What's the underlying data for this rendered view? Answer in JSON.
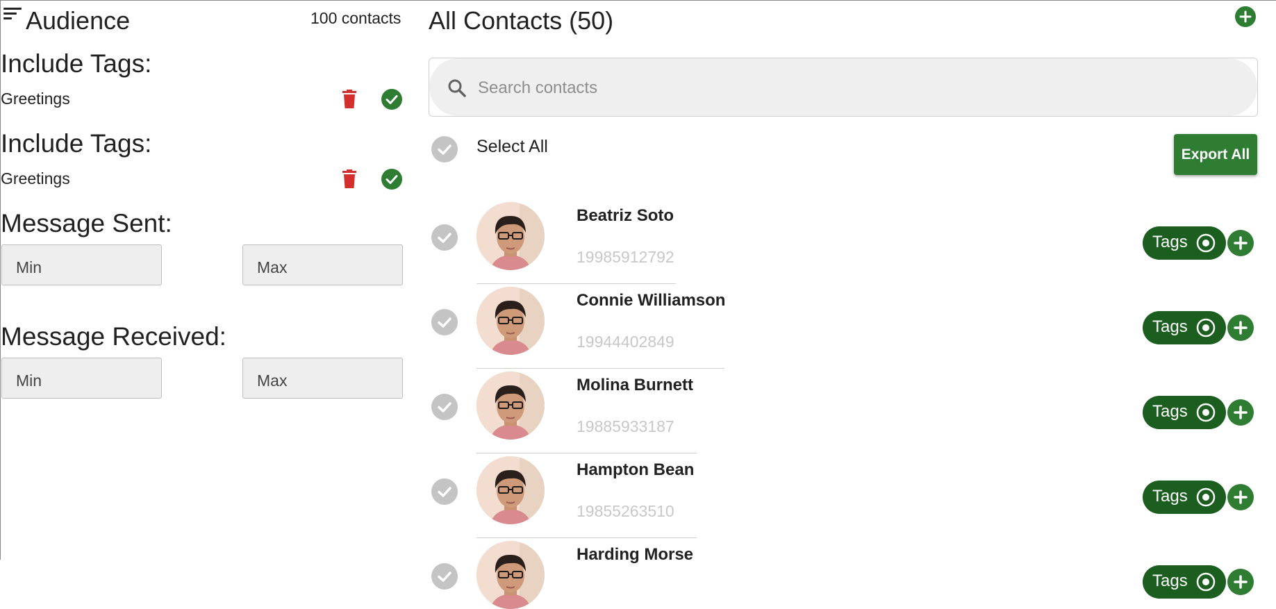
{
  "audience": {
    "title": "Audience",
    "count": "100 contacts",
    "include_sections": [
      {
        "heading": "Include Tags:",
        "tag": "Greetings"
      },
      {
        "heading": "Include Tags:",
        "tag": "Greetings"
      }
    ],
    "message_sent": {
      "heading": "Message Sent:",
      "min_placeholder": "Min",
      "max_placeholder": "Max"
    },
    "message_received": {
      "heading": "Message Received:",
      "min_placeholder": "Min",
      "max_placeholder": "Max"
    }
  },
  "contacts": {
    "title": "All Contacts (50)",
    "search_placeholder": "Search contacts",
    "select_all_label": "Select All",
    "export_label": "Export All",
    "tags_label": "Tags",
    "list": [
      {
        "name": "Beatriz Soto",
        "phone": "19985912792"
      },
      {
        "name": "Connie Williamson",
        "phone": "19944402849"
      },
      {
        "name": "Molina Burnett",
        "phone": "19885933187"
      },
      {
        "name": "Hampton Bean",
        "phone": "19855263510"
      },
      {
        "name": "Harding Morse",
        "phone": ""
      }
    ]
  },
  "icons": {
    "sort": "sort-icon",
    "delete": "trash-icon",
    "confirm": "check-circle-icon",
    "add": "plus-icon",
    "search": "search-icon",
    "select": "check-icon",
    "target": "radio-target-icon"
  },
  "colors": {
    "accent_green": "#2e7d32",
    "tags_green": "#1b5e20",
    "delete_red": "#d32f2f",
    "unchecked_gray": "#c4c4c4"
  }
}
